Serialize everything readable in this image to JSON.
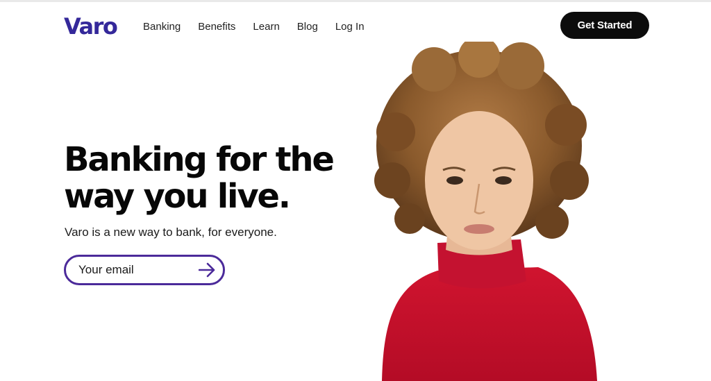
{
  "brand": {
    "logo_text": "Varo",
    "logo_color": "#34289a"
  },
  "nav": {
    "items": [
      {
        "label": "Banking"
      },
      {
        "label": "Benefits"
      },
      {
        "label": "Learn"
      },
      {
        "label": "Blog"
      },
      {
        "label": "Log In"
      }
    ]
  },
  "header": {
    "cta_label": "Get Started"
  },
  "hero": {
    "title_line1": "Banking for the",
    "title_line2": "way you live.",
    "subtitle": "Varo is a new way to bank, for everyone.",
    "email_placeholder": "Your email",
    "submit_icon": "arrow-right-icon",
    "accent_color": "#4b2a9a",
    "photo": "person-in-red-turtleneck"
  },
  "colors": {
    "cta_bg": "#0c0c0c",
    "sweater": "#c8102e",
    "hair": "#8a5a2c"
  }
}
